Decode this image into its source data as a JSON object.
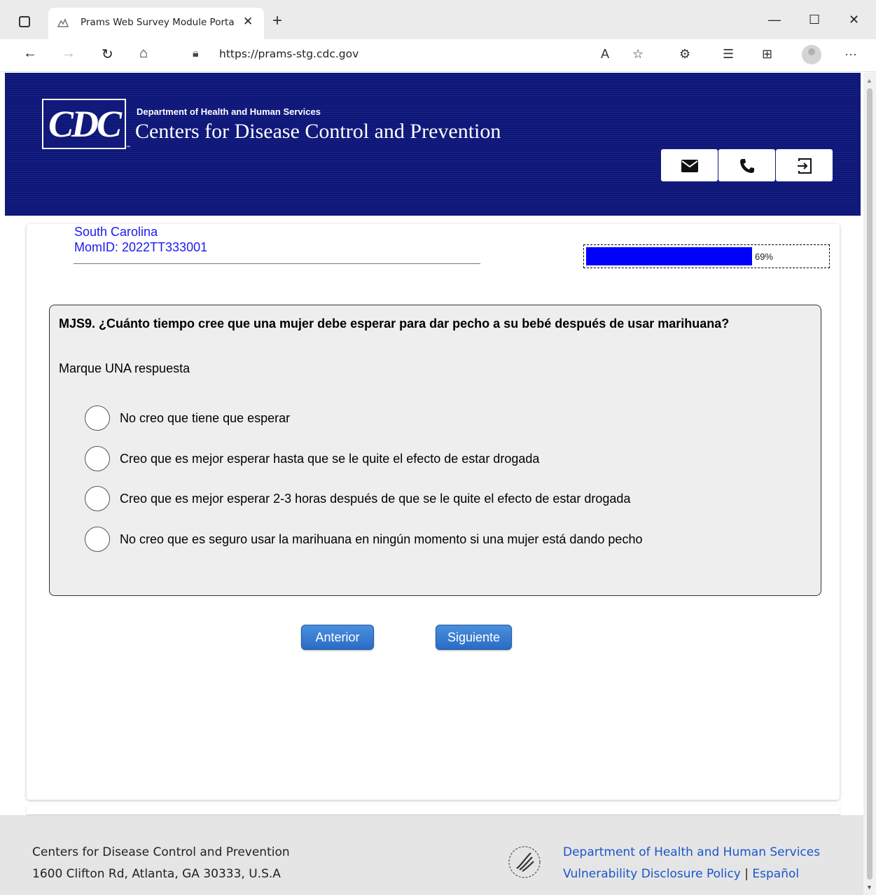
{
  "browser": {
    "tab_title": "Prams Web Survey Module Porta",
    "url": "https://prams-stg.cdc.gov",
    "icons": {
      "tab_actions": "tab-actions-icon",
      "favicon": "favicon-icon",
      "close": "close-icon",
      "new_tab": "plus-icon",
      "back": "back-arrow-icon",
      "forward": "forward-arrow-icon",
      "refresh": "refresh-icon",
      "home": "home-icon",
      "lock": "lock-icon",
      "read_aloud": "read-aloud-icon",
      "favorite": "add-favorite-icon",
      "extensions": "extensions-icon",
      "favorites": "favorites-icon",
      "collections": "collections-icon",
      "profile": "profile-icon",
      "more": "more-icon"
    }
  },
  "header": {
    "logo_text": "CDC",
    "dept_small": "Department of Health and Human Services",
    "dept_large": "Centers for Disease Control and Prevention",
    "buttons": [
      "email-icon",
      "phone-icon",
      "logout-icon"
    ],
    "colors": {
      "banner": "#0c1578"
    }
  },
  "survey": {
    "state": "South Carolina",
    "momid": "MomID: 2022TT333001",
    "progress": {
      "value": 69,
      "label": "69%",
      "color": "#0000ff"
    },
    "question": {
      "text": "MJS9. ¿Cuánto tiempo cree que una mujer debe esperar para dar pecho a su bebé después de usar marihuana?",
      "instruction": "Marque UNA respuesta",
      "options": [
        "No creo que tiene que esperar",
        "Creo que es mejor esperar hasta que se le quite el efecto de estar drogada",
        "Creo que es mejor esperar 2-3 horas después de que se le quite el efecto de estar drogada",
        "No creo que es seguro usar la marihuana en ningún momento si una mujer está dando pecho"
      ]
    },
    "buttons": {
      "prev": "Anterior",
      "next": "Siguiente"
    }
  },
  "footer": {
    "org": "Centers for Disease Control and Prevention",
    "address": "1600 Clifton Rd, Atlanta, GA 30333, U.S.A",
    "hhs_link": "Department of Health and Human Services",
    "vdp_link": "Vulnerability Disclosure Policy",
    "separator": "|",
    "espanol_link": "Español"
  }
}
